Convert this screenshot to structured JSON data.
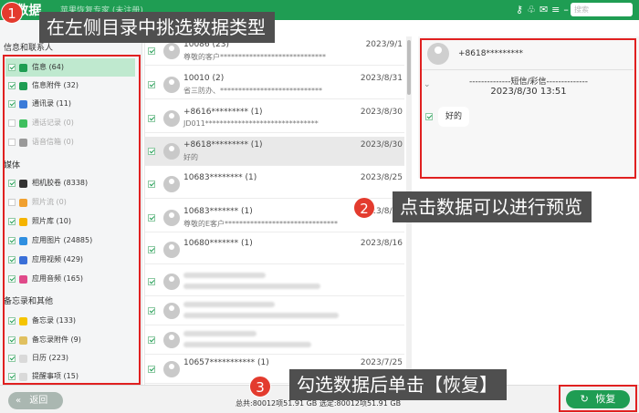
{
  "titlebar": {
    "logo": "数据",
    "title": "苹果恢复专家 (未注册)",
    "icons": [
      "cart-icon",
      "user-icon",
      "help-icon",
      "key-icon",
      "gift-icon",
      "chat-icon",
      "menu-icon",
      "minimize-icon",
      "close-icon"
    ],
    "search_placeholder": "搜索"
  },
  "sidebar": {
    "groups": [
      {
        "header": "信息和联系人",
        "items": [
          {
            "label": "信息 (64)",
            "checked": true,
            "color": "#1f9d53",
            "selected": true
          },
          {
            "label": "信息附件 (32)",
            "checked": true,
            "color": "#1f9d53"
          },
          {
            "label": "通讯录 (11)",
            "checked": true,
            "color": "#3b7bd8"
          },
          {
            "label": "通话记录 (0)",
            "checked": false,
            "color": "#3fbf5f",
            "disabled": true
          },
          {
            "label": "语音信箱 (0)",
            "checked": false,
            "color": "#999999",
            "disabled": true
          }
        ]
      },
      {
        "header": "媒体",
        "items": [
          {
            "label": "相机胶卷 (8338)",
            "checked": true,
            "color": "#333333"
          },
          {
            "label": "照片流 (0)",
            "checked": false,
            "color": "#f0a030",
            "disabled": true
          },
          {
            "label": "照片库 (10)",
            "checked": true,
            "color": "#f5b400"
          },
          {
            "label": "应用图片 (24885)",
            "checked": true,
            "color": "#2f8fe0"
          },
          {
            "label": "应用视频 (429)",
            "checked": true,
            "color": "#3a6fd8"
          },
          {
            "label": "应用音频 (165)",
            "checked": true,
            "color": "#e04a8a"
          }
        ]
      },
      {
        "header": "备忘录和其他",
        "items": [
          {
            "label": "备忘录 (133)",
            "checked": true,
            "color": "#f5c400"
          },
          {
            "label": "备忘录附件 (9)",
            "checked": true,
            "color": "#e0c060"
          },
          {
            "label": "日历 (223)",
            "checked": true,
            "color": "#d9d9d9"
          },
          {
            "label": "提醒事项 (15)",
            "checked": true,
            "color": "#d9d9d9"
          }
        ]
      }
    ]
  },
  "list": {
    "rows": [
      {
        "name": "10086 (23)",
        "date": "2023/9/1",
        "preview": "尊敬的客户*****************************",
        "active": false
      },
      {
        "name": "10010 (2)",
        "date": "2023/8/31",
        "preview": "省三防办、****************************",
        "active": false
      },
      {
        "name": "+8616********* (1)",
        "date": "2023/8/30",
        "preview": "JD011*******************************",
        "active": false
      },
      {
        "name": "+8618********* (1)",
        "date": "2023/8/30",
        "preview": "好的",
        "active": true
      },
      {
        "name": "10683******** (1)",
        "date": "2023/8/25",
        "preview": "",
        "active": false
      },
      {
        "name": "10683******* (1)",
        "date": "2023/8/25",
        "preview": "尊敬的E客户*******************************",
        "active": false
      },
      {
        "name": "10680******* (1)",
        "date": "2023/8/16",
        "preview": "",
        "active": false
      },
      {
        "name": "",
        "date": "",
        "preview": "",
        "active": false,
        "blurred": true
      },
      {
        "name": "",
        "date": "",
        "preview": "",
        "active": false,
        "blurred": true
      },
      {
        "name": "",
        "date": "",
        "preview": "",
        "active": false,
        "blurred": true
      },
      {
        "name": "",
        "date": "",
        "preview": "",
        "active": false,
        "blurred": true
      },
      {
        "name": "10657*********** (1)",
        "date": "2023/7/25",
        "preview": "",
        "active": false
      }
    ]
  },
  "preview": {
    "number": "+8618*********",
    "type_line": "--------------短信/彩信--------------",
    "datetime": "2023/8/30 13:51",
    "message": "好的"
  },
  "bottombar": {
    "back_label": "返回",
    "status": "总共:80012项51.91 GB 选定:80012项51.91 GB",
    "recover_label": "恢复"
  },
  "callouts": [
    {
      "num": "1",
      "text": "在左侧目录中挑选数据类型"
    },
    {
      "num": "2",
      "text": "点击数据可以进行预览"
    },
    {
      "num": "3",
      "text": "勾选数据后单击【恢复】"
    }
  ],
  "colors": {
    "brand_green": "#1f9d53",
    "highlight_red": "#e02020",
    "callout_bg": "#4f4f4f",
    "badge_red": "#e33b2e"
  }
}
